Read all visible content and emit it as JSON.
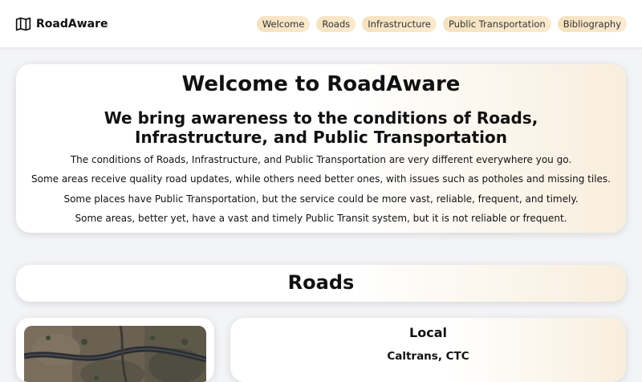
{
  "brand": {
    "name": "RoadAware",
    "icon": "map-icon"
  },
  "nav": {
    "items": [
      {
        "label": "Welcome"
      },
      {
        "label": "Roads"
      },
      {
        "label": "Infrastructure"
      },
      {
        "label": "Public Transportation"
      },
      {
        "label": "Bibliography"
      }
    ]
  },
  "hero": {
    "title": "Welcome to RoadAware",
    "subtitle": "We bring awareness to the conditions of Roads, Infrastructure, and Public Transportation",
    "paragraphs": [
      "The conditions of Roads, Infrastructure, and Public Transportation are very different everywhere you go.",
      "Some areas receive quality road updates, while others need better ones, with issues such as potholes and missing tiles.",
      "Some places have Public Transportation, but the service could be more vast, reliable, frequent, and timely.",
      "Some areas, better yet, have a vast and timely Public Transit system, but it is not reliable or frequent."
    ]
  },
  "roads": {
    "title": "Roads",
    "local": {
      "title": "Local",
      "subtitle": "Caltrans, CTC"
    }
  },
  "colors": {
    "accent": "#f6e2bf",
    "page_background": "#f3f4f6",
    "card_gradient_end": "#f8eedd"
  }
}
